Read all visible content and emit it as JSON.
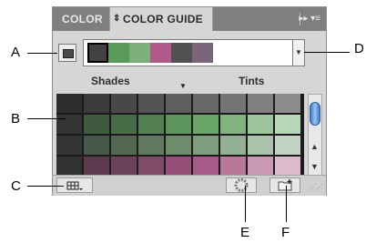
{
  "tabs": {
    "inactive": "COLOR",
    "active": "COLOR GUIDE",
    "active_icon": "⇕",
    "menu_icon": "▸▸  ▾≡"
  },
  "swatch_section": {
    "base_color": "#4b4b4b",
    "harmony_colors": [
      "#424242",
      "#589b58",
      "#7bb07b",
      "#b05a8a",
      "#515151",
      "#7b657b"
    ]
  },
  "labels": {
    "shades": "Shades",
    "tints": "Tints"
  },
  "grid": {
    "rows": [
      [
        "#2e2e2e",
        "#3c3c3c",
        "#484848",
        "#545454",
        "#5e5e5e",
        "#696969",
        "#747474",
        "#808080",
        "#8c8c8c"
      ],
      [
        "#333333",
        "#3f5a3f",
        "#486c48",
        "#528052",
        "#5c945c",
        "#6aa66a",
        "#82b482",
        "#9dc49d",
        "#b9d6b9"
      ],
      [
        "#343434",
        "#485848",
        "#536853",
        "#607a60",
        "#6c8c6c",
        "#7d9d7d",
        "#93af93",
        "#aac1aa",
        "#c3d4c3"
      ],
      [
        "#323232",
        "#5a3a4c",
        "#6b4259",
        "#7e4b69",
        "#934f78",
        "#a65b88",
        "#b87899",
        "#ca98b2",
        "#dcbacb"
      ],
      [
        "#2f2f2f",
        "#4a404a",
        "#574a57",
        "#655565",
        "#736073",
        "#826d82",
        "#958495",
        "#a99ca9",
        "#beb5be"
      ]
    ]
  },
  "callouts": {
    "a": "A",
    "b": "B",
    "c": "C",
    "d": "D",
    "e": "E",
    "f": "F"
  }
}
